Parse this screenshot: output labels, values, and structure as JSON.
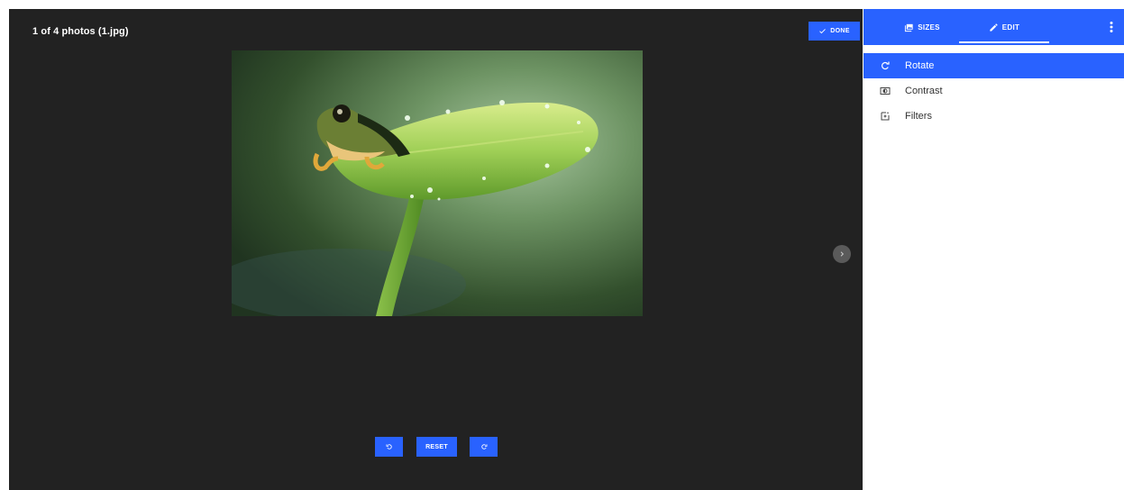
{
  "viewer": {
    "photo_title": "1 of 4 photos (1.jpg)",
    "done_label": "DONE",
    "reset_label": "RESET"
  },
  "sidebar": {
    "tabs": [
      {
        "label": "SIZES",
        "icon": "photo-library-icon"
      },
      {
        "label": "EDIT",
        "icon": "pencil-icon",
        "active": true
      }
    ],
    "menu": [
      {
        "label": "Rotate",
        "icon": "rotate-icon",
        "active": true
      },
      {
        "label": "Contrast",
        "icon": "contrast-icon"
      },
      {
        "label": "Filters",
        "icon": "filters-icon"
      }
    ]
  },
  "colors": {
    "accent": "#2962ff",
    "viewer_bg": "#222222",
    "sidebar_bg": "#ffffff"
  }
}
